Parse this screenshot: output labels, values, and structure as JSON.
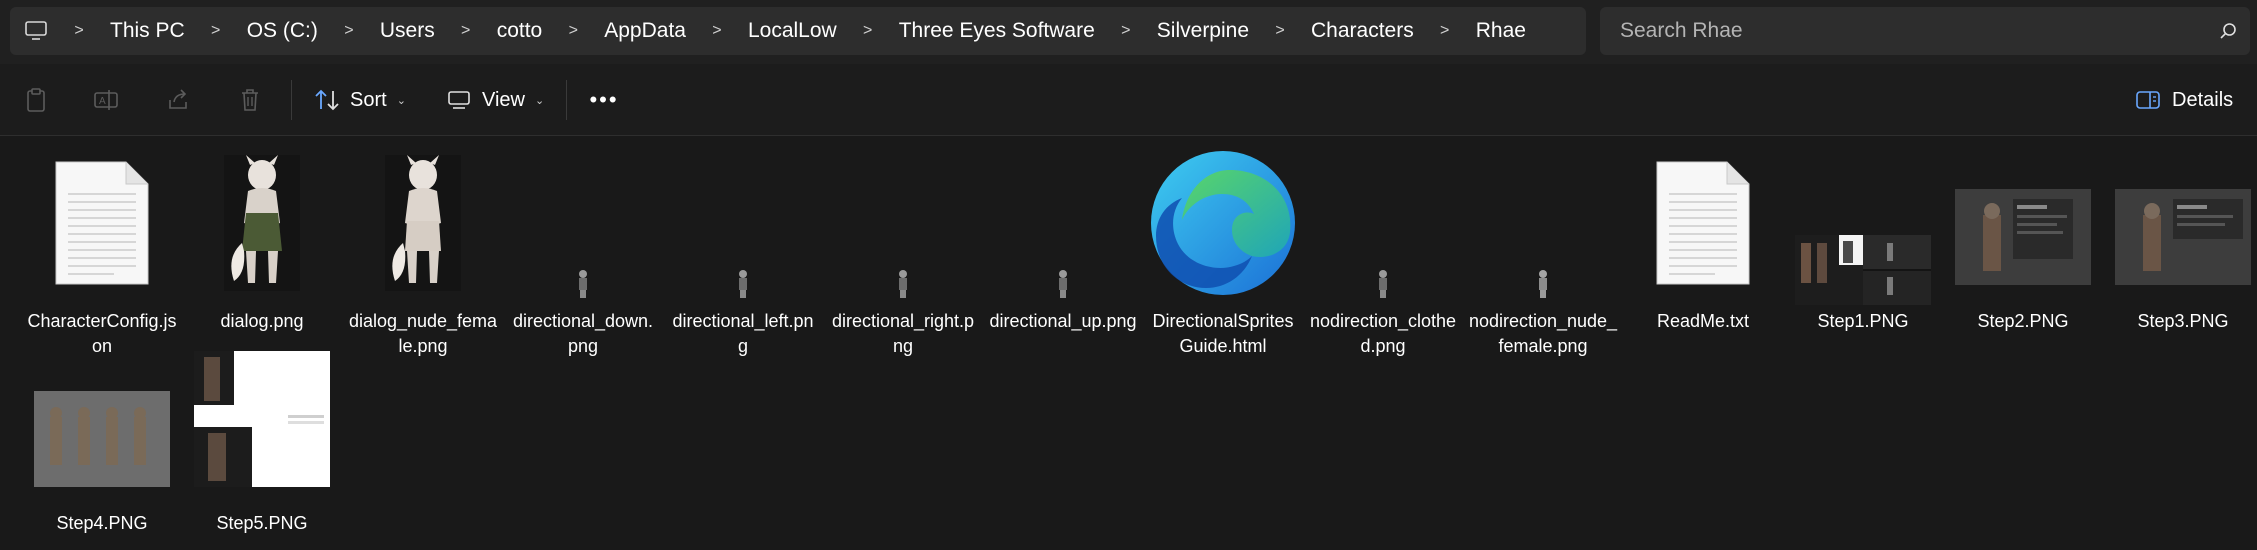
{
  "address": {
    "crumbs": [
      "This PC",
      "OS (C:)",
      "Users",
      "cotto",
      "AppData",
      "LocalLow",
      "Three Eyes Software",
      "Silverpine",
      "Characters",
      "Rhae"
    ]
  },
  "search": {
    "placeholder": "Search Rhae"
  },
  "toolbar": {
    "sort_label": "Sort",
    "view_label": "View",
    "details_label": "Details"
  },
  "files": [
    {
      "name": "CharacterConfig.json",
      "kind": "document"
    },
    {
      "name": "dialog.png",
      "kind": "portrait"
    },
    {
      "name": "dialog_nude_female.png",
      "kind": "portrait"
    },
    {
      "name": "directional_down.png",
      "kind": "sprite"
    },
    {
      "name": "directional_left.png",
      "kind": "sprite"
    },
    {
      "name": "directional_right.png",
      "kind": "sprite"
    },
    {
      "name": "directional_up.png",
      "kind": "sprite"
    },
    {
      "name": "DirectionalSpritesGuide.html",
      "kind": "edge"
    },
    {
      "name": "nodirection_clothed.png",
      "kind": "sprite"
    },
    {
      "name": "nodirection_nude_female.png",
      "kind": "sprite"
    },
    {
      "name": "ReadMe.txt",
      "kind": "document"
    },
    {
      "name": "Step1.PNG",
      "kind": "step1"
    },
    {
      "name": "Step2.PNG",
      "kind": "step2"
    },
    {
      "name": "Step3.PNG",
      "kind": "step3"
    },
    {
      "name": "Step4.PNG",
      "kind": "step4"
    },
    {
      "name": "Step5.PNG",
      "kind": "step5"
    }
  ]
}
